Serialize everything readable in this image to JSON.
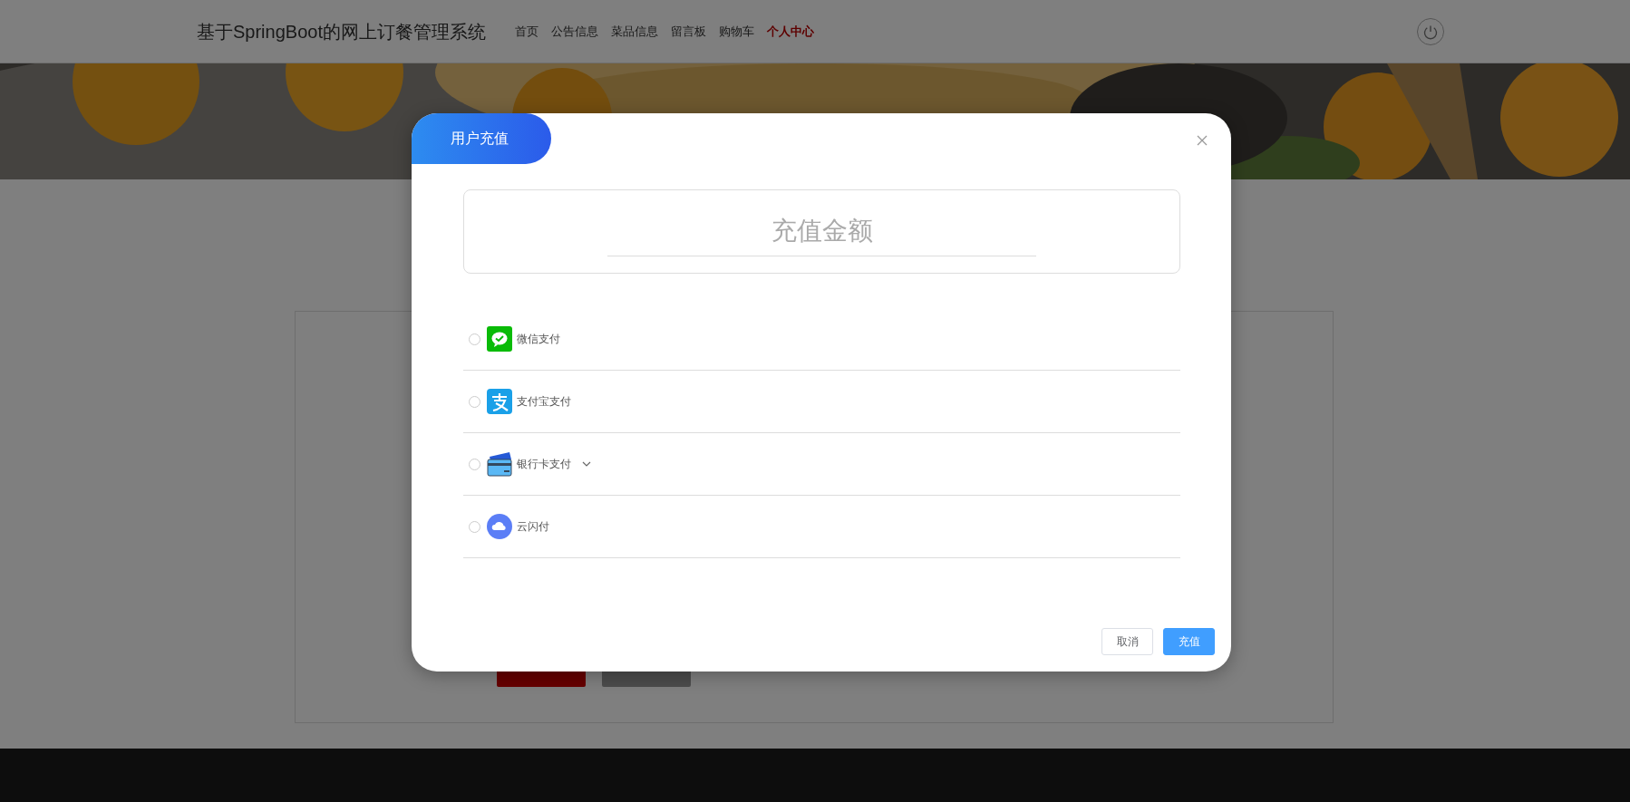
{
  "navbar": {
    "title": "基于SpringBoot的网上订餐管理系统",
    "links": [
      {
        "label": "首页",
        "selected": false
      },
      {
        "label": "公告信息",
        "selected": false
      },
      {
        "label": "菜品信息",
        "selected": false
      },
      {
        "label": "留言板",
        "selected": false
      },
      {
        "label": "购物车",
        "selected": false
      },
      {
        "label": "个人中心",
        "selected": true
      }
    ]
  },
  "dialog": {
    "title": "用户充值",
    "amount": {
      "placeholder": "充值金额"
    },
    "payment_methods": [
      {
        "kind": "wechat",
        "label": "微信支付",
        "selected": false,
        "dropdown": false
      },
      {
        "kind": "alipay",
        "label": "支付宝支付",
        "selected": false,
        "dropdown": false
      },
      {
        "kind": "bankcard",
        "label": "银行卡支付",
        "selected": false,
        "dropdown": true
      },
      {
        "kind": "unionpay",
        "label": "云闪付",
        "selected": false,
        "dropdown": false
      }
    ],
    "buttons": [
      {
        "kind": "default",
        "label": "取消"
      },
      {
        "kind": "primary",
        "label": "充值"
      }
    ]
  }
}
